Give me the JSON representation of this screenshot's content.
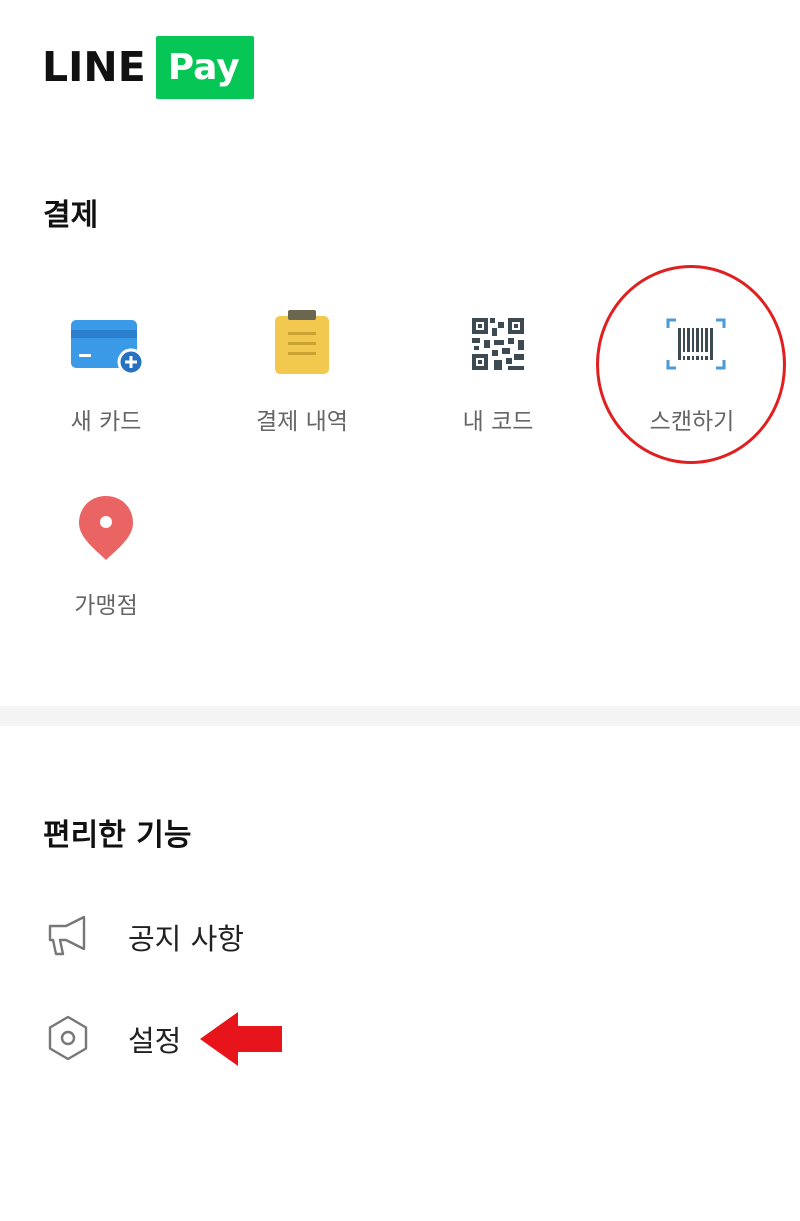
{
  "logo": {
    "line": "LINE",
    "pay": "Pay",
    "brand_color": "#06c755"
  },
  "payment": {
    "title": "결제",
    "tiles": [
      {
        "label": "새 카드",
        "icon": "credit-card-add-icon",
        "color": "#2f8fe0"
      },
      {
        "label": "결제 내역",
        "icon": "clipboard-icon",
        "color": "#f1c84b"
      },
      {
        "label": "내 코드",
        "icon": "qr-code-icon",
        "color": "#3d4a52"
      },
      {
        "label": "스캔하기",
        "icon": "barcode-scan-icon",
        "color": "#4a9bd8"
      },
      {
        "label": "가맹점",
        "icon": "map-pin-icon",
        "color": "#ea6464"
      }
    ]
  },
  "convenience": {
    "title": "편리한 기능",
    "items": [
      {
        "label": "공지 사항",
        "icon": "megaphone-icon"
      },
      {
        "label": "설정",
        "icon": "gear-hexagon-icon"
      }
    ]
  },
  "annotations": {
    "highlight_color": "#e02020"
  }
}
